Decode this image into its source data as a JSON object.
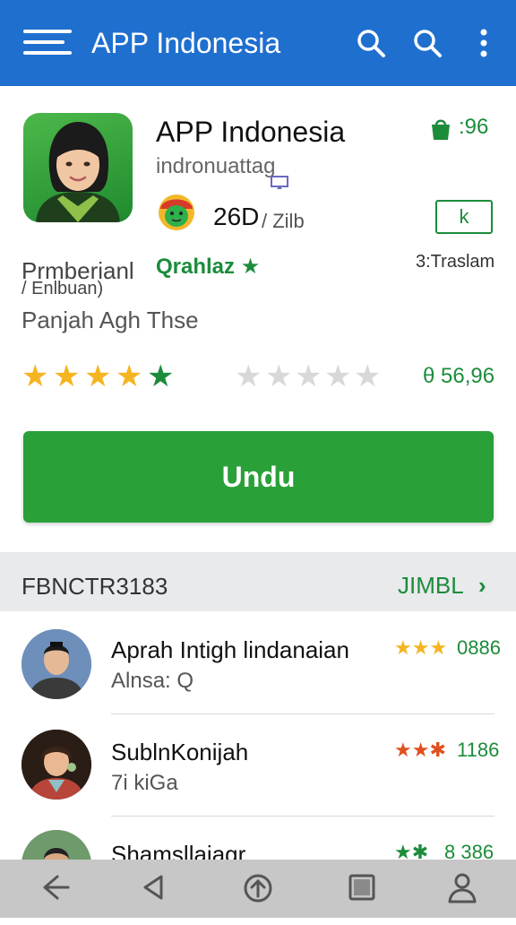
{
  "appbar": {
    "title": "APP Indonesia"
  },
  "app": {
    "name": "APP Indonesia",
    "developer": "indronuattag",
    "rating_count": "26D",
    "rating_suffix": "/ Zilb",
    "price": ":96",
    "k_button_label": "k",
    "k_sub": "3:Traslam",
    "category": "Prmberianl",
    "category_sub": "/ Enlbuan)",
    "tag": "Qrahlaz",
    "tag_star": "★",
    "description": "Panjah Agh Thse",
    "rating_percent": "θ 56,96",
    "stars_filled": 5,
    "stars_total": 5,
    "colors": {
      "brand_blue": "#1f6fcf",
      "accent_green": "#2aa038",
      "star_orange": "#f5b421"
    }
  },
  "install_button": {
    "label": "Undu"
  },
  "reviews_section": {
    "title": "FBNCTR3183",
    "link_label": "JIMBL",
    "link_chevron": "›",
    "items": [
      {
        "name": "Aprah Intigh lindanaian",
        "sub": "Alnsa: Q",
        "stars": "★★★",
        "value": "0886"
      },
      {
        "name": "SublnKonijah",
        "sub": "7i kiGa",
        "stars": "★★✱",
        "value": "1186"
      },
      {
        "name": "Shamsllajagr",
        "sub": "",
        "stars": "★✱",
        "value": "8 386"
      }
    ]
  },
  "navbar": {
    "icons": [
      "back-arrow-icon",
      "triangle-back-icon",
      "home-icon",
      "recents-icon",
      "profile-icon"
    ]
  }
}
